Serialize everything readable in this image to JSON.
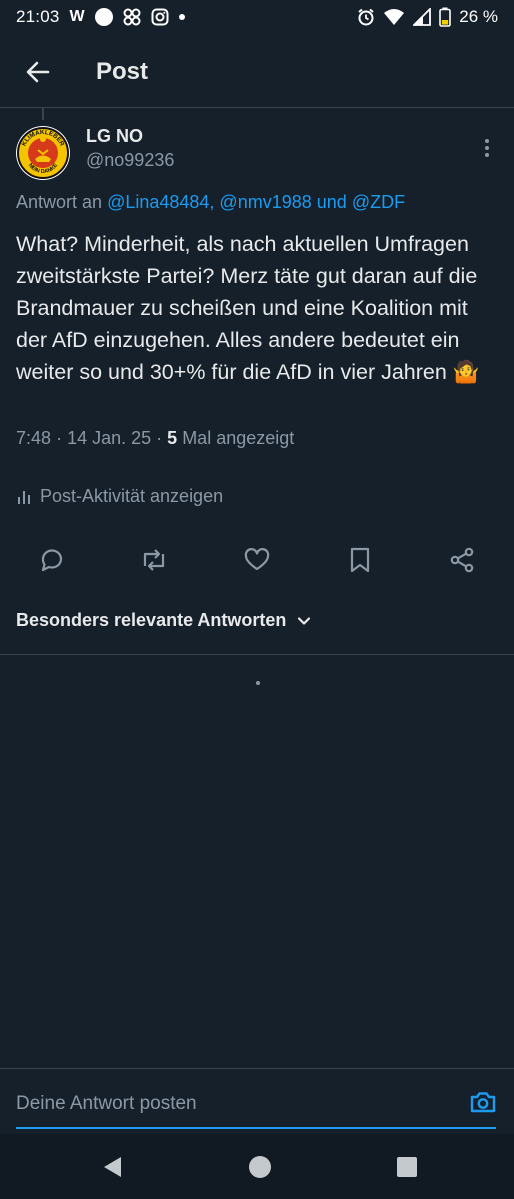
{
  "status_bar": {
    "time": "21:03",
    "carrier_letter": "W",
    "battery": "26 %",
    "icons": [
      "circle-icon",
      "pinwheel-icon",
      "instagram-icon",
      "dot-icon",
      "alarm-icon",
      "wifi-icon",
      "signal-icon",
      "battery-icon"
    ]
  },
  "header": {
    "title": "Post",
    "back_icon": "arrow-left-icon"
  },
  "post": {
    "author_name": "LG NO",
    "author_handle": "@no99236",
    "reply_prefix": "Antwort an",
    "reply_targets": "@Lina48484, @nmv1988",
    "reply_conjunction": "und",
    "reply_last": "@ZDF",
    "text": "What? Minderheit, als nach aktuellen Umfragen zweitstärkste Partei? Merz täte gut daran auf die Brandmauer zu scheißen und eine Koalition mit der AfD einzugehen. Alles andere bedeutet ein weiter so und 30+% für die AfD in vier Jahren 🤷",
    "time": "7:48",
    "date": "14 Jan. 25",
    "views_count": "5",
    "views_label": "Mal angezeigt",
    "avatar_text_top": "KLIMAKLEBER",
    "avatar_text_bottom": "NEIN DANKE"
  },
  "activity": {
    "label": "Post-Aktivität anzeigen",
    "icon": "bar-chart-icon"
  },
  "actions": [
    "reply-icon",
    "repost-icon",
    "like-icon",
    "bookmark-icon",
    "share-icon"
  ],
  "replies_sort": {
    "label": "Besonders relevante Antworten",
    "icon": "chevron-down-icon"
  },
  "reply_bar": {
    "placeholder": "Deine Antwort posten",
    "icon": "camera-icon"
  },
  "colors": {
    "background": "#15202b",
    "accent": "#1d9bf0",
    "muted": "#8b98a5",
    "text": "#e7e9ea",
    "divider": "#38444d"
  },
  "nav_bar": {
    "icons": [
      "back-triangle-icon",
      "home-circle-icon",
      "recents-square-icon"
    ]
  }
}
